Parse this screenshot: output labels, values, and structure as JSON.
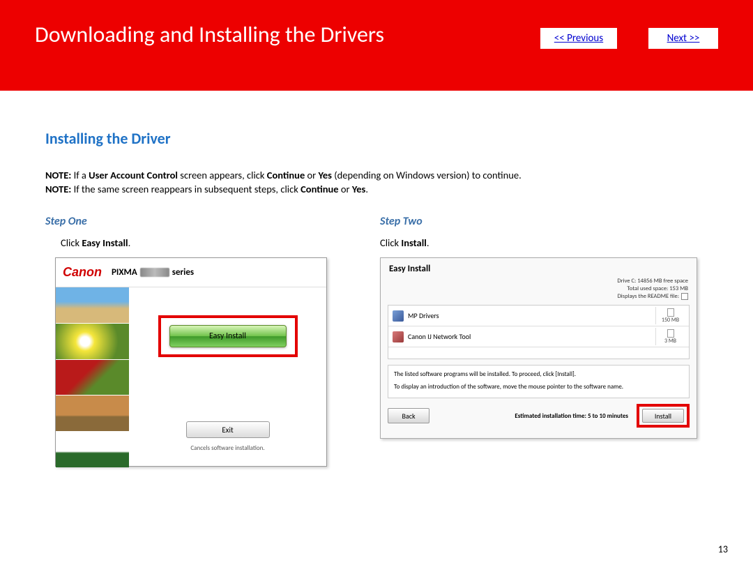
{
  "header": {
    "title": "Downloading and Installing  the Drivers",
    "prev": "<< Previous",
    "next": "Next >>"
  },
  "section_heading": "Installing the Driver",
  "notes": {
    "n1_prefix": "NOTE:",
    "n1_a": " If a ",
    "n1_b": "User Account Control",
    "n1_c": " screen appears, click ",
    "n1_d": "Continue",
    "n1_e": " or ",
    "n1_f": "Yes",
    "n1_g": " (depending on Windows version) to continue.",
    "n2_prefix": "NOTE:",
    "n2_a": " If the same screen reappears in subsequent steps, click ",
    "n2_b": "Continue",
    "n2_c": " or ",
    "n2_d": "Yes",
    "n2_e": "."
  },
  "step1": {
    "title": "Step One",
    "instr_a": "Click ",
    "instr_b": "Easy Install",
    "instr_c": ".",
    "logo": "Canon",
    "pixma_a": "PIXMA",
    "pixma_b": "series",
    "easy_btn": "Easy Install",
    "exit_btn": "Exit",
    "exit_caption": "Cancels software installation."
  },
  "step2": {
    "title": "Step Two",
    "instr_a": "Click ",
    "instr_b": "Install",
    "instr_c": ".",
    "win_title": "Easy Install",
    "stat1": "Drive C: 14856 MB free space",
    "stat2": "Total used space: 153 MB",
    "stat3": "Displays the README file:",
    "pkg1_name": "MP Drivers",
    "pkg1_size": "150 MB",
    "pkg2_name": "Canon IJ Network Tool",
    "pkg2_size": "3 MB",
    "info1": "The listed software programs will be installed. To proceed, click [Install].",
    "info2": "To display an introduction of the software, move the mouse pointer to the software name.",
    "back_btn": "Back",
    "est": "Estimated installation time: 5 to 10 minutes",
    "install_btn": "Install"
  },
  "page_number": "13"
}
